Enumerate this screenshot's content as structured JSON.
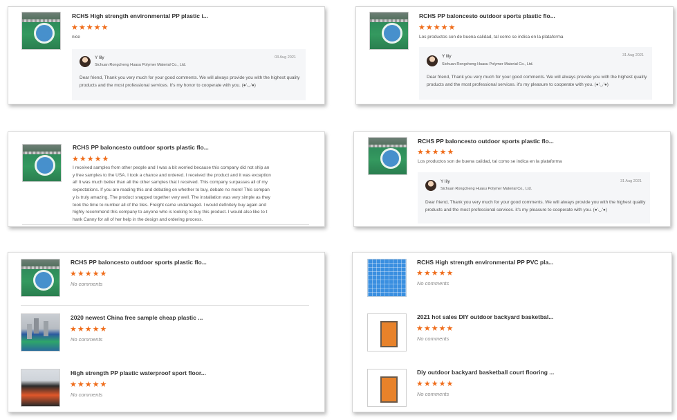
{
  "colors": {
    "star": "#ef6c1a",
    "card_border": "#d6d6d6",
    "reply_bg": "#f5f6f8"
  },
  "stars": "★★★★★",
  "cards": [
    {
      "title": "RCHS High strength environmental PP plastic i...",
      "comment": "nice",
      "reply": {
        "name": "Y lily",
        "company": "Sichuan Rongcheng Huasu Polymer Material Co., Ltd.",
        "date": "03 Aug 2021",
        "text": "Dear friend, Thank you very much for your good comments. We will always provide you with the highest quality products and the most professional services. It's my honor to cooperate with you. (●'◡'●)"
      }
    },
    {
      "title": "RCHS PP baloncesto outdoor sports plastic flo...",
      "comment": "Los productos son de buena calidad, tal como se indica en la plataforma",
      "reply": {
        "name": "Y lily",
        "company": "Sichuan Rongcheng Huasu Polymer Material Co., Ltd.",
        "date": "31 Aug 2021",
        "text": "Dear friend, Thank you very much for your good comments. We will always provide you with the highest quality products and the most professional services. it's my pleasure to cooperate with you. (●'◡'●)"
      }
    },
    {
      "title": "RCHS PP baloncesto outdoor sports plastic flo...",
      "comment_lines": [
        "I received samples from other people and I was a bit worried because this company did not ship an",
        "y free samples to the USA. I took a chance and ordered. I received the product and it was exception",
        "al! It was much better than all the other samples that I received. This company surpasses all of my",
        "expectations. If you are reading this and debating on whether to buy, debate no more! This compan",
        "y is truly amazing. The product snapped together very well. The installation was very simple as they",
        "took the time to number all of the tiles. Freight came undamaged. I would definitely buy again and",
        "highly recommend this company to anyone who is looking to buy this product. I would also like to t",
        "hank Canny for all of her help in the design and ordering process."
      ]
    },
    {
      "title": "RCHS PP baloncesto outdoor sports plastic flo...",
      "comment": "Los productos son de buena calidad, tal como se indica en la plataforma",
      "reply": {
        "name": "Y lily",
        "company": "Sichuan Rongcheng Huasu Polymer Material Co., Ltd.",
        "date": "31 Aug 2021",
        "text": "Dear friend, Thank you very much for your good comments. We will always provide you with the highest quality products and the most professional services. it's my pleasure to cooperate with you. (●'◡'●)"
      }
    }
  ],
  "list_left": [
    {
      "title": "RCHS PP baloncesto outdoor sports plastic flo...",
      "comment": "No comments"
    },
    {
      "title": "2020 newest China free sample cheap plastic ...",
      "comment": "No comments"
    },
    {
      "title": "High strength PP plastic waterproof sport floor...",
      "comment": "No comments"
    }
  ],
  "list_right": [
    {
      "title": "RCHS High strength environmental PP PVC pla...",
      "comment": "No comments"
    },
    {
      "title": "2021 hot sales DIY outdoor backyard basketbal...",
      "comment": "No comments"
    },
    {
      "title": "Diy outdoor backyard basketball court flooring ...",
      "comment": "No comments"
    }
  ]
}
